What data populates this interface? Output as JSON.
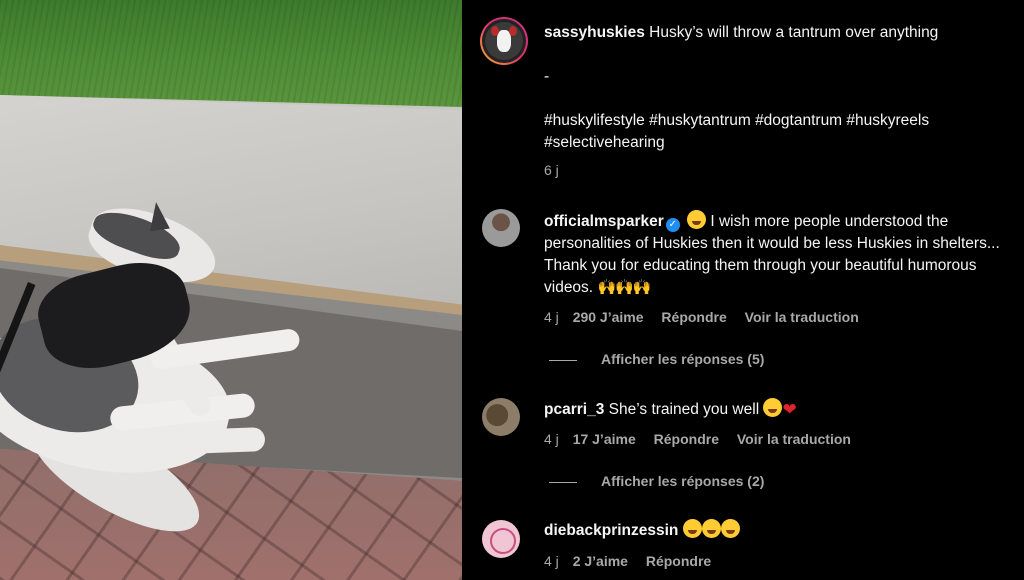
{
  "post": {
    "username": "sassyhuskies",
    "caption": "Husky’s will throw a tantrum over anything",
    "separator": "-",
    "hashtags_line1": "#huskylifestyle #huskytantrum #dogtantrum #huskyreels",
    "hashtags_line2": "#selectivehearing",
    "time": "6 j"
  },
  "comments": [
    {
      "username": "officialmsparker",
      "verified": true,
      "text": "I wish more people understood the personalities of Huskies then it would be less Huskies in shelters... Thank you for educating them through your beautiful humorous videos.",
      "time": "4 j",
      "likes": "290 J’aime",
      "reply": "Répondre",
      "translate": "Voir la traduction",
      "view_replies": "Afficher les réponses (5)"
    },
    {
      "username": "pcarri_3",
      "text": "She’s trained you well",
      "time": "4 j",
      "likes": "17 J’aime",
      "reply": "Répondre",
      "translate": "Voir la traduction",
      "view_replies": "Afficher les réponses (2)"
    },
    {
      "username": "diebackprinzessin",
      "text": "",
      "time": "4 j",
      "likes": "2 J’aime",
      "reply": "Répondre"
    }
  ],
  "icons": {
    "verified": "verified-badge-icon",
    "laughing": "laughing-emoji-icon",
    "heart": "red-heart-emoji-icon",
    "raised_hands": "raised-hands-emoji-icon"
  },
  "colors": {
    "background": "#000000",
    "text": "#f5f5f5",
    "secondary_text": "#a8a8a8",
    "verified_blue": "#1f8ef1"
  }
}
